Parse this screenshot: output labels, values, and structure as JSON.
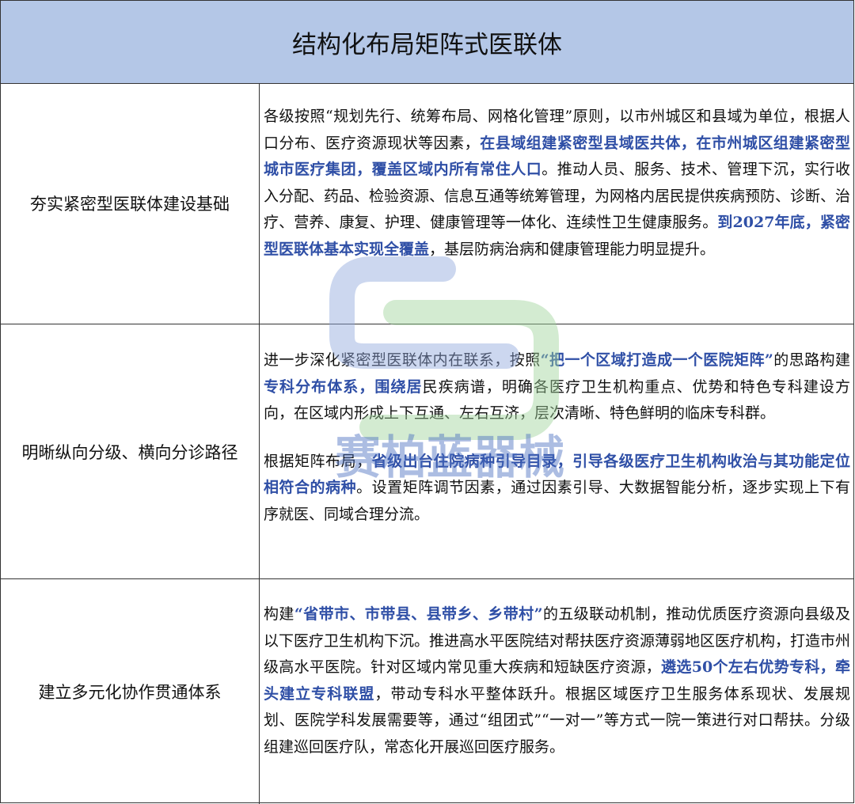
{
  "title": "结构化布局矩阵式医联体",
  "rows": [
    {
      "label": "夯实紧密型医联体建设基础",
      "paragraphs": [
        {
          "segments": [
            {
              "text": "各级按照“规划先行、统筹布局、网格化管理”原则，以市州城区和县域为单位，根据人口分布、医疗资源现状等因素，",
              "highlight": false
            },
            {
              "text": "在县域组建紧密型县域医共体，在市州城区组建紧密型城市医疗集团，覆盖区域内所有常住人口",
              "highlight": true
            },
            {
              "text": "。推动人员、服务、技术、管理下沉，实行收入分配、药品、检验资源、信息互通等统筹管理，为网格内居民提供疾病预防、诊断、治疗、营养、康复、护理、健康管理等一体化、连续性卫生健康服务。",
              "highlight": false
            },
            {
              "text": "到2027年底，紧密型医联体基本实现全覆盖",
              "highlight": true
            },
            {
              "text": "，基层防病治病和健康管理能力明显提升。",
              "highlight": false
            }
          ]
        }
      ]
    },
    {
      "label": "明晰纵向分级、横向分诊路径",
      "paragraphs": [
        {
          "segments": [
            {
              "text": "进一步深化紧密型医联体内在联系，按照",
              "highlight": false
            },
            {
              "text": "“把一个区域打造成一个医院矩阵”",
              "highlight": true
            },
            {
              "text": "的思路构建",
              "highlight": false
            },
            {
              "text": "专科分布体系，围绕居",
              "highlight": true
            },
            {
              "text": "民疾病谱，明确各医疗卫生机构重点、优势和特色专科建设方向，在区域内形成上下互通、左右互济，层次清晰、特色鲜明的临床专科群。",
              "highlight": false
            }
          ]
        },
        {
          "segments": [
            {
              "text": "根据矩阵布局，",
              "highlight": false
            },
            {
              "text": "省级出台住院病种引导目录，引导各级医疗卫生机构收治与其功能定位相符合的病种",
              "highlight": true
            },
            {
              "text": "。设置矩阵调节因素，通过因素引导、大数据智能分析，逐步实现上下有序就医、同域合理分流。",
              "highlight": false
            }
          ]
        }
      ]
    },
    {
      "label": "建立多元化协作贯通体系",
      "paragraphs": [
        {
          "segments": [
            {
              "text": "构建",
              "highlight": false
            },
            {
              "text": "“省带市、市带县、县带乡、乡带村”",
              "highlight": true
            },
            {
              "text": "的五级联动机制，推动优质医疗资源向县级及以下医疗卫生机构下沉。推进高水平医院结对帮扶医疗资源薄弱地区医疗机构，打造市州级高水平医院。针对区域内常见重大疾病和短缺医疗资源，",
              "highlight": false
            },
            {
              "text": "遴选50个左右优势专科，牵头建立专科联盟",
              "highlight": true
            },
            {
              "text": "，带动专科水平整体跃升。根据区域医疗卫生服务体系现状、发展规划、医院学科发展需要等，通过“组团式”“一对一”等方式一院一策进行对口帮扶。分级组建巡回医疗队，常态化开展巡回医疗服务。",
              "highlight": false
            }
          ]
        }
      ]
    }
  ],
  "watermark": {
    "text": "赛柏蓝器械",
    "color": "#4a6fc1",
    "logo_colors": [
      "#8fa7dd",
      "#9fd39a"
    ]
  }
}
